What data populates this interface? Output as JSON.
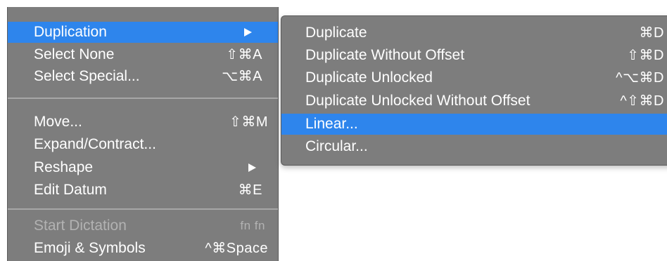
{
  "main_menu": {
    "items": [
      {
        "label": "Duplication",
        "shortcut": "",
        "has_submenu": true,
        "highlighted": true
      },
      {
        "label": "Select None",
        "shortcut": "⇧⌘A"
      },
      {
        "label": "Select Special...",
        "shortcut": "⌥⌘A"
      },
      {
        "label": "Move...",
        "shortcut": "⇧⌘M"
      },
      {
        "label": "Expand/Contract...",
        "shortcut": ""
      },
      {
        "label": "Reshape",
        "shortcut": "",
        "has_submenu": true
      },
      {
        "label": "Edit Datum",
        "shortcut": "⌘E"
      },
      {
        "label": "Start Dictation",
        "shortcut": "fn fn",
        "disabled": true
      },
      {
        "label": "Emoji & Symbols",
        "shortcut": "^⌘Space"
      }
    ]
  },
  "sub_menu": {
    "items": [
      {
        "label": "Duplicate",
        "shortcut": "⌘D"
      },
      {
        "label": "Duplicate Without Offset",
        "shortcut": "⇧⌘D"
      },
      {
        "label": "Duplicate Unlocked",
        "shortcut": "^⌥⌘D"
      },
      {
        "label": "Duplicate Unlocked Without Offset",
        "shortcut": "^⇧⌘D"
      },
      {
        "label": "Linear...",
        "shortcut": "",
        "highlighted": true
      },
      {
        "label": "Circular...",
        "shortcut": ""
      }
    ]
  },
  "colors": {
    "menu_background": "#7d7d7d",
    "highlight": "#2e85ec",
    "text": "#ffffff",
    "disabled_text": "#b2b2b2",
    "separator": "#a7a7a7"
  },
  "icons": {
    "submenu_arrow": "triangle-right-icon"
  }
}
